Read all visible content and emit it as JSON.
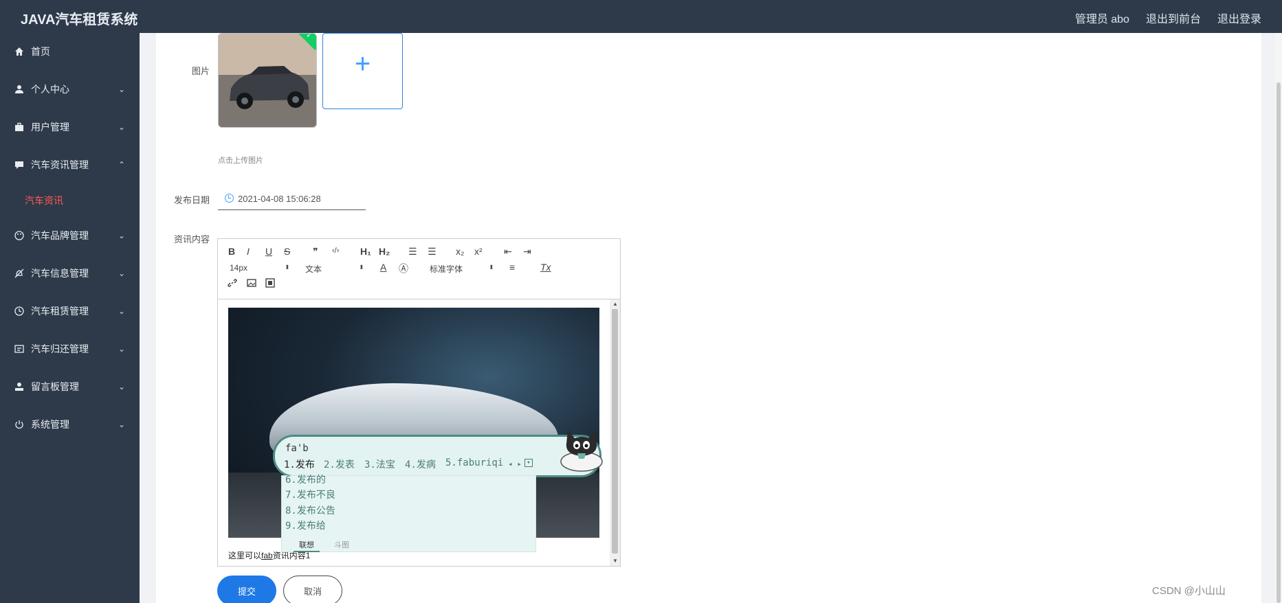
{
  "header": {
    "title": "JAVA汽车租赁系统",
    "user": "管理员 abo",
    "back_to_front": "退出到前台",
    "logout": "退出登录"
  },
  "sidebar": {
    "items": [
      {
        "label": "首页",
        "icon": "home-icon",
        "arrow": ""
      },
      {
        "label": "个人中心",
        "icon": "user-icon",
        "arrow": "⌄"
      },
      {
        "label": "用户管理",
        "icon": "briefcase-icon",
        "arrow": "⌄"
      },
      {
        "label": "汽车资讯管理",
        "icon": "chat-icon",
        "arrow": "⌃"
      },
      {
        "label": "汽车品牌管理",
        "icon": "palette-icon",
        "arrow": "⌄"
      },
      {
        "label": "汽车信息管理",
        "icon": "bell-off-icon",
        "arrow": "⌄"
      },
      {
        "label": "汽车租赁管理",
        "icon": "clock-icon",
        "arrow": "⌄"
      },
      {
        "label": "汽车归还管理",
        "icon": "return-icon",
        "arrow": "⌄"
      },
      {
        "label": "留言板管理",
        "icon": "person-icon",
        "arrow": "⌄"
      },
      {
        "label": "系统管理",
        "icon": "power-icon",
        "arrow": "⌄"
      }
    ],
    "active_sub": "汽车资讯"
  },
  "form": {
    "image_label": "图片",
    "upload_plus": "+",
    "upload_hint": "点击上传图片",
    "date_label": "发布日期",
    "date_value": "2021-04-08 15:06:28",
    "content_label": "资讯内容"
  },
  "editor": {
    "toolbar": {
      "bold": "B",
      "italic": "I",
      "underline": "U",
      "strike": "S",
      "quote": "❞",
      "code": "‹/›",
      "h1": "H₁",
      "h2": "H₂",
      "ol": "☰",
      "ul": "☰",
      "sub": "x₂",
      "sup": "x²",
      "outdent": "⇤",
      "indent": "⇥",
      "size": "14px",
      "format": "文本",
      "color": "A",
      "bg": "Ⓐ",
      "font": "标准字体",
      "align": "≡",
      "clear": "Tx",
      "link": "🔗",
      "image": "▣",
      "video": "▤"
    },
    "content_text_before": "这里可以",
    "content_text_typed": "fab",
    "content_text_after": "资讯内容1"
  },
  "ime": {
    "pinyin": "fa'b",
    "candidates": [
      "1.发布",
      "2.发表",
      "3.法宝",
      "4.发病",
      "5.faburiqi"
    ],
    "more": [
      "6.发布的",
      "7.发布不良",
      "8.发布公告",
      "9.发布给"
    ],
    "tab_active": "联想",
    "tab_other": "斗图",
    "nav": "◂ ▸"
  },
  "buttons": {
    "submit": "提交",
    "cancel": "取消"
  },
  "watermark": "CSDN @小山山"
}
